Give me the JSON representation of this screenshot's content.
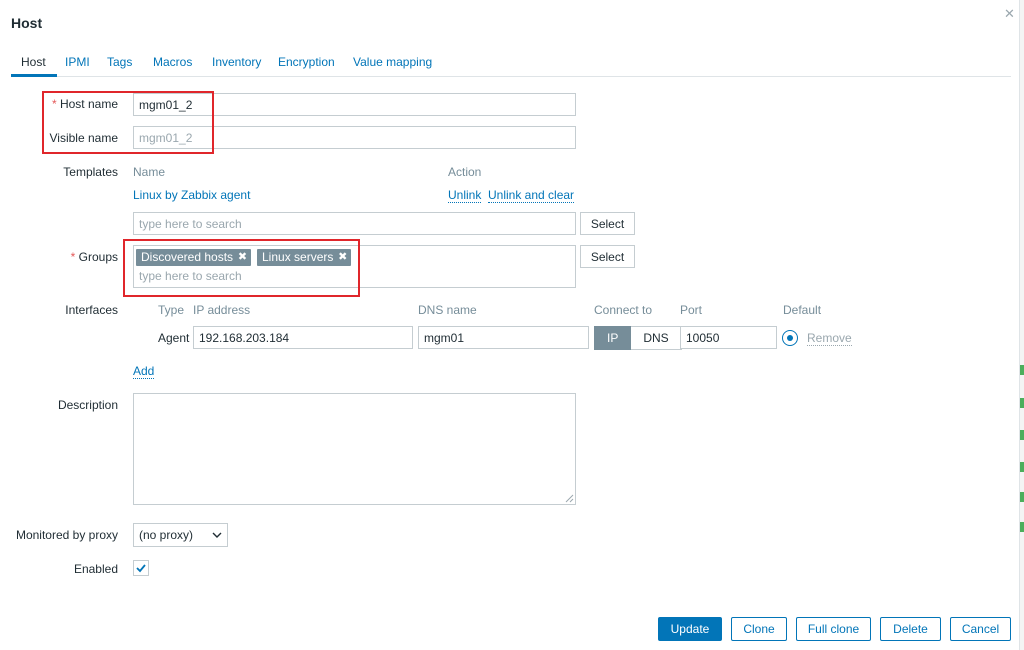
{
  "dialog": {
    "title": "Host",
    "close_icon": "✕"
  },
  "tabs": [
    {
      "label": "Host",
      "active": true
    },
    {
      "label": "IPMI"
    },
    {
      "label": "Tags"
    },
    {
      "label": "Macros"
    },
    {
      "label": "Inventory"
    },
    {
      "label": "Encryption"
    },
    {
      "label": "Value mapping"
    }
  ],
  "form": {
    "host_name": {
      "required_mark": "*",
      "label": "Host name",
      "value": "mgm01_2"
    },
    "visible_name": {
      "label": "Visible name",
      "placeholder": "mgm01_2"
    },
    "templates": {
      "label": "Templates",
      "col_name": "Name",
      "col_action": "Action",
      "linked": [
        {
          "name": "Linux by Zabbix agent",
          "unlink": "Unlink",
          "unlink_clear": "Unlink and clear"
        }
      ],
      "search_placeholder": "type here to search",
      "select_label": "Select"
    },
    "groups": {
      "required_mark": "*",
      "label": "Groups",
      "items": [
        {
          "label": "Discovered hosts"
        },
        {
          "label": "Linux servers"
        }
      ],
      "remove_glyph": "✖",
      "search_placeholder": "type here to search",
      "select_label": "Select"
    },
    "interfaces": {
      "label": "Interfaces",
      "headers": {
        "type": "Type",
        "ip": "IP address",
        "dns": "DNS name",
        "connect": "Connect to",
        "port": "Port",
        "default": "Default"
      },
      "rows": [
        {
          "type": "Agent",
          "ip": "192.168.203.184",
          "dns": "mgm01",
          "connect_ip": "IP",
          "connect_dns": "DNS",
          "connect_selected": "IP",
          "port": "10050",
          "default": true,
          "remove": "Remove"
        }
      ],
      "add": "Add"
    },
    "description": {
      "label": "Description",
      "value": ""
    },
    "proxy": {
      "label": "Monitored by proxy",
      "value": "(no proxy)"
    },
    "enabled": {
      "label": "Enabled",
      "checked": true
    }
  },
  "footer": {
    "update": "Update",
    "clone": "Clone",
    "full_clone": "Full clone",
    "delete": "Delete",
    "cancel": "Cancel"
  },
  "colors": {
    "accent": "#0275b8",
    "required": "#e45959",
    "chip": "#768d99",
    "highlight_box": "#e0262b"
  }
}
